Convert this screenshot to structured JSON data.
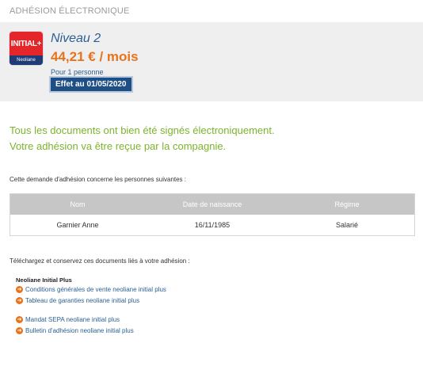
{
  "page": {
    "section_title": "ADHÉSION ÉLECTRONIQUE"
  },
  "summary": {
    "logo_top": "INITIAL+",
    "logo_bottom": "Neoliane",
    "plan_name": "Niveau 2",
    "price": "44,21 € / mois",
    "persons": "Pour 1 personne",
    "effect": "Effet au 01/05/2020"
  },
  "message": {
    "line1": "Tous les documents ont bien été signés électroniquement.",
    "line2": "Votre adhésion va être reçue par la compagnie."
  },
  "concern_text": "Cette demande d'adhésion concerne les personnes suivantes :",
  "table": {
    "headers": [
      "Nom",
      "Date de naissance",
      "Régime"
    ],
    "rows": [
      [
        "Garnier Anne",
        "16/11/1985",
        "Salarié"
      ]
    ]
  },
  "download_text": "Téléchargez et conservez ces documents liés à votre adhésion :",
  "documents": {
    "group_title": "Neoliane Initial Plus",
    "links": [
      "Conditions générales de vente neoliane initial plus",
      "Tableau de garanties neoliane initial plus",
      "Mandat SEPA neoliane initial plus",
      "Bulletin d'adhésion neoliane initial plus"
    ],
    "arrow_glyph": "➜"
  },
  "colors": {
    "accent_orange": "#e8731c",
    "success_green": "#7cb32c",
    "brand_blue": "#1e4e86",
    "link_blue": "#2c5f93"
  }
}
